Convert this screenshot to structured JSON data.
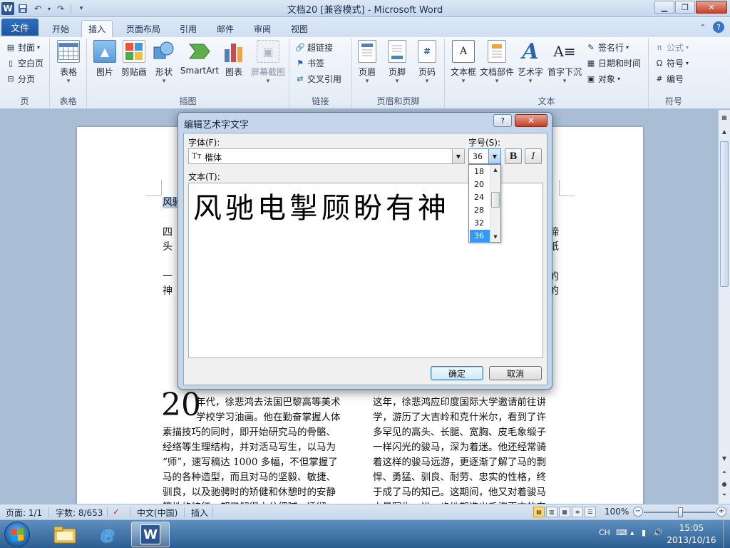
{
  "titlebar": {
    "app_title": "文档20 [兼容模式] - Microsoft Word",
    "qat_word": "W"
  },
  "tabs": {
    "file": "文件",
    "items": [
      "开始",
      "插入",
      "页面布局",
      "引用",
      "邮件",
      "审阅",
      "视图"
    ],
    "active": "插入"
  },
  "ribbon": {
    "page_group": {
      "label": "页",
      "cover": "封面",
      "blank": "空白页",
      "break": "分页"
    },
    "table_group": {
      "label": "表格",
      "table": "表格"
    },
    "illustrations": {
      "label": "插图",
      "picture": "图片",
      "clipart": "剪贴画",
      "shapes": "形状",
      "smartart": "SmartArt",
      "chart": "图表",
      "screenshot": "屏幕截图"
    },
    "links": {
      "label": "链接",
      "hyperlink": "超链接",
      "bookmark": "书签",
      "crossref": "交叉引用"
    },
    "header_footer": {
      "label": "页眉和页脚",
      "header": "页眉",
      "footer": "页脚",
      "page_number": "页码"
    },
    "text": {
      "label": "文本",
      "textbox": "文本框",
      "quickparts": "文档部件",
      "wordart": "艺术字",
      "dropcap": "首字下沉",
      "signature": "签名行",
      "datetime": "日期和时间",
      "object": "对象"
    },
    "symbols": {
      "label": "符号",
      "equation": "公式",
      "symbol": "符号",
      "number": "编号"
    }
  },
  "document": {
    "selected_line": "风驰",
    "para1_a": "四",
    "para1_b": "头",
    "para2_a": "一",
    "para2_b": "神",
    "right_1": "蹄",
    "right_2": "纸",
    "right_3": "的",
    "right_4": "的",
    "dropcap": "20",
    "left_col": [
      "年代，徐悲鸿去法国巴黎高等美术",
      "学校学习油画。他在勤奋掌握人体",
      "素描技巧的同时，即开始研究马的骨骼、",
      "经络等生理结构，并对活马写生，以马为",
      "“师”，速写稿达 1000 多幅，不但掌握了",
      "马的各种造型，而且对马的坚毅、敏捷、",
      "驯良，以及驰骋时的矫健和休憩时的安静",
      "等性格特征，都了解得十分细腻、透彻"
    ],
    "right_col": [
      "这年，徐悲鸿应印度国际大学邀请前往讲",
      "学，游历了大吉岭和克什米尔，看到了许",
      "多罕见的高头、长腿、宽胸、皮毛象缎子",
      "一样闪光的骏马，深为着迷。他还经常骑",
      "着这样的骏马远游，更逐渐了解了马的剽",
      "悍、勇猛、驯良、耐劳、忠实的性格，终",
      "于成了马的知己。这期间，他又对着骏马",
      "大量写生，进一步地塑造出千姿百态的奔"
    ]
  },
  "dialog": {
    "title": "编辑艺术字文字",
    "help": "?",
    "close": "✕",
    "font_label": "字体(F):",
    "font_value": "楷体",
    "font_icon": "Tт",
    "size_label": "字号(S):",
    "size_value": "36",
    "bold": "B",
    "italic": "I",
    "text_label": "文本(T):",
    "text_value": "风驰电掣顾盼有神",
    "size_options": [
      "18",
      "20",
      "24",
      "28",
      "32",
      "36"
    ],
    "selected_size": "36",
    "ok": "确定",
    "cancel": "取消"
  },
  "statusbar": {
    "page": "页面: 1/1",
    "words": "字数: 8/653",
    "language": "中文(中国)",
    "mode": "插入",
    "zoom": "100%",
    "zoom_minus": "−",
    "zoom_plus": "+"
  },
  "taskbar": {
    "ime": "CH",
    "time": "15:05",
    "date": "2013/10/16"
  },
  "colors": {
    "accent": "#2b5797",
    "file_tab": "#1d56a3",
    "selection": "#3399ff"
  }
}
